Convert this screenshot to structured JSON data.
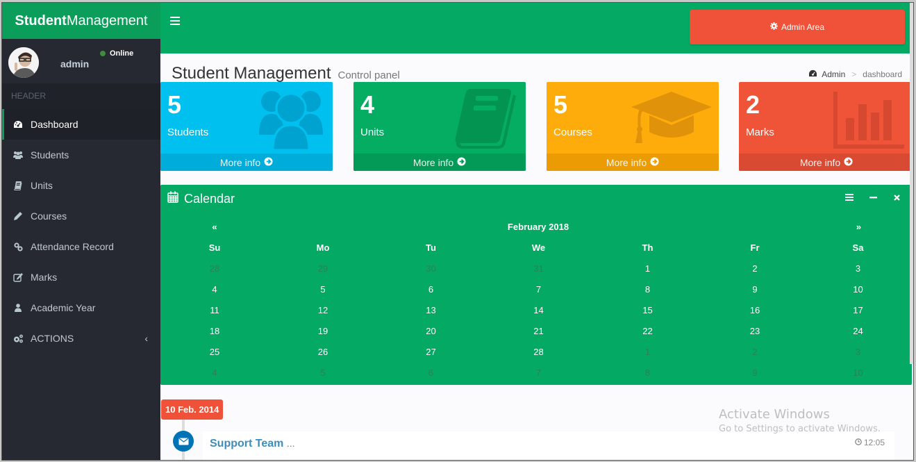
{
  "brand": {
    "bold": "Student",
    "light": "Management"
  },
  "user": {
    "name": "admin",
    "status": "Online"
  },
  "sidebar": {
    "header": "HEADER",
    "items": [
      {
        "label": "Dashboard",
        "icon": "dashboard-icon",
        "active": true
      },
      {
        "label": "Students",
        "icon": "users-icon"
      },
      {
        "label": "Units",
        "icon": "book-icon"
      },
      {
        "label": "Courses",
        "icon": "pencil-icon"
      },
      {
        "label": "Attendance Record",
        "icon": "link-icon"
      },
      {
        "label": "Marks",
        "icon": "edit-icon"
      },
      {
        "label": "Academic Year",
        "icon": "user-icon"
      },
      {
        "label": "ACTIONS",
        "icon": "cogs-icon",
        "has_submenu": true
      }
    ]
  },
  "topnav": {
    "admin_button": "Admin Area"
  },
  "page": {
    "title": "Student Management",
    "subtitle": "Control panel"
  },
  "breadcrumb": {
    "home": "Admin",
    "separator": ">",
    "current": "dashboard"
  },
  "stats": [
    {
      "value": "5",
      "label": "Students",
      "link": "More info",
      "color": "#00c0ef"
    },
    {
      "value": "4",
      "label": "Units",
      "link": "More info",
      "color": "#04ad62"
    },
    {
      "value": "5",
      "label": "Courses",
      "link": "More info",
      "color": "#feac0c"
    },
    {
      "value": "2",
      "label": "Marks",
      "link": "More info",
      "color": "#f05438"
    }
  ],
  "calendar": {
    "title": "Calendar",
    "month": "February 2018",
    "prev": "«",
    "next": "»",
    "weekdays": [
      "Su",
      "Mo",
      "Tu",
      "We",
      "Th",
      "Fr",
      "Sa"
    ],
    "weeks": [
      [
        {
          "d": "28",
          "o": true
        },
        {
          "d": "29",
          "o": true
        },
        {
          "d": "30",
          "o": true
        },
        {
          "d": "31",
          "o": true
        },
        {
          "d": "1"
        },
        {
          "d": "2"
        },
        {
          "d": "3"
        }
      ],
      [
        {
          "d": "4"
        },
        {
          "d": "5"
        },
        {
          "d": "6"
        },
        {
          "d": "7"
        },
        {
          "d": "8"
        },
        {
          "d": "9"
        },
        {
          "d": "10"
        }
      ],
      [
        {
          "d": "11"
        },
        {
          "d": "12"
        },
        {
          "d": "13"
        },
        {
          "d": "14"
        },
        {
          "d": "15"
        },
        {
          "d": "16"
        },
        {
          "d": "17"
        }
      ],
      [
        {
          "d": "18"
        },
        {
          "d": "19"
        },
        {
          "d": "20"
        },
        {
          "d": "21"
        },
        {
          "d": "22"
        },
        {
          "d": "23"
        },
        {
          "d": "24"
        }
      ],
      [
        {
          "d": "25"
        },
        {
          "d": "26"
        },
        {
          "d": "27"
        },
        {
          "d": "28"
        },
        {
          "d": "1",
          "o": true
        },
        {
          "d": "2",
          "o": true
        },
        {
          "d": "3",
          "o": true
        }
      ],
      [
        {
          "d": "4",
          "o": true
        },
        {
          "d": "5",
          "o": true
        },
        {
          "d": "6",
          "o": true
        },
        {
          "d": "7",
          "o": true
        },
        {
          "d": "8",
          "o": true
        },
        {
          "d": "9",
          "o": true
        },
        {
          "d": "10",
          "o": true
        }
      ]
    ]
  },
  "timeline": {
    "date": "10 Feb. 2014",
    "item": {
      "title": "Support Team",
      "more": "...",
      "time": "12:05"
    }
  },
  "watermark": {
    "line1": "Activate Windows",
    "line2": "Go to Settings to activate Windows."
  }
}
